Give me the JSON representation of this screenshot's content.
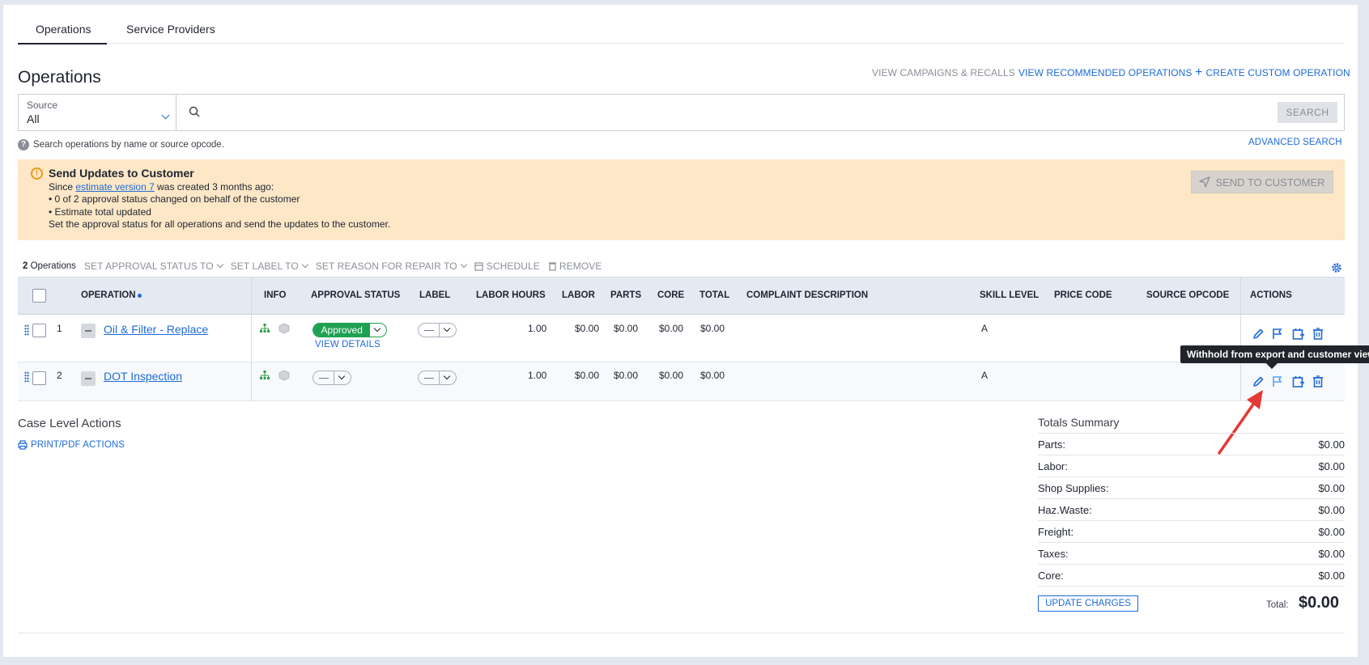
{
  "tabs": [
    {
      "label": "Operations"
    },
    {
      "label": "Service Providers"
    }
  ],
  "page_title": "Operations",
  "header_links": {
    "campaigns": "VIEW CAMPAIGNS & RECALLS",
    "recommended": "VIEW RECOMMENDED OPERATIONS",
    "create": "CREATE CUSTOM OPERATION"
  },
  "search": {
    "source_label": "Source",
    "source_value": "All",
    "button": "SEARCH",
    "hint": "Search operations by name or source opcode.",
    "advanced": "ADVANCED SEARCH"
  },
  "alert": {
    "title": "Send Updates to Customer",
    "since": "Since",
    "version_link": "estimate version 7",
    "created": "was created 3 months ago:",
    "bullet1": "• 0 of 2 approval status changed on behalf of the customer",
    "bullet2": "• Estimate total updated",
    "footer": "Set the approval status for all operations and send the updates to the customer.",
    "button": "SEND TO CUSTOMER"
  },
  "toolbar": {
    "count": "2",
    "count_label": "Operations",
    "approval": "SET APPROVAL STATUS TO",
    "label": "SET LABEL TO",
    "reason": "SET REASON FOR REPAIR TO",
    "schedule": "SCHEDULE",
    "remove": "REMOVE"
  },
  "table": {
    "headers": {
      "operation": "OPERATION",
      "info": "INFO",
      "approval": "APPROVAL STATUS",
      "label": "LABEL",
      "labor_hours": "LABOR HOURS",
      "labor": "LABOR",
      "parts": "PARTS",
      "core": "CORE",
      "total": "TOTAL",
      "complaint": "COMPLAINT DESCRIPTION",
      "skill": "SKILL LEVEL",
      "price_code": "PRICE CODE",
      "source_opcode": "SOURCE OPCODE",
      "actions": "ACTIONS"
    },
    "rows": [
      {
        "num": "1",
        "name": "Oil & Filter - Replace",
        "approval": "Approved",
        "view_details": "VIEW DETAILS",
        "labor_hours": "1.00",
        "labor": "$0.00",
        "parts": "$0.00",
        "core": "$0.00",
        "total": "$0.00",
        "skill": "A"
      },
      {
        "num": "2",
        "name": "DOT Inspection",
        "approval": "",
        "labor_hours": "1.00",
        "labor": "$0.00",
        "parts": "$0.00",
        "core": "$0.00",
        "total": "$0.00",
        "skill": "A"
      }
    ]
  },
  "tooltip": "Withhold from export and customer view.",
  "case_actions": {
    "title": "Case Level Actions",
    "print": "PRINT/PDF ACTIONS"
  },
  "totals": {
    "title": "Totals Summary",
    "rows": [
      {
        "label": "Parts:",
        "value": "$0.00"
      },
      {
        "label": "Labor:",
        "value": "$0.00"
      },
      {
        "label": "Shop Supplies:",
        "value": "$0.00"
      },
      {
        "label": "Haz.Waste:",
        "value": "$0.00"
      },
      {
        "label": "Freight:",
        "value": "$0.00"
      },
      {
        "label": "Taxes:",
        "value": "$0.00"
      },
      {
        "label": "Core:",
        "value": "$0.00"
      }
    ],
    "update_button": "UPDATE CHARGES",
    "total_label": "Total:",
    "total_value": "$0.00"
  },
  "colors": {
    "accent": "#1e6bd6",
    "approved": "#1fa152",
    "alert_bg": "#fde7c6",
    "annotation_arrow": "#e53935"
  }
}
